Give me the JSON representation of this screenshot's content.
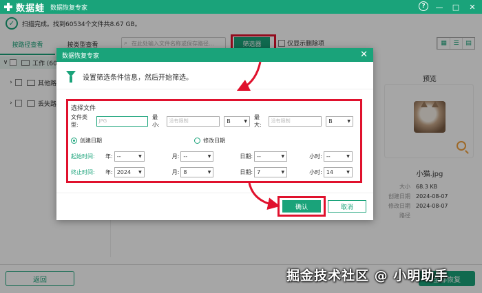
{
  "app": {
    "brand": "数据蛙",
    "subtitle": "数据恢复专家",
    "window_controls": [
      "?",
      "—",
      "□",
      "✕"
    ]
  },
  "status": {
    "text": "扫描完成。找到60534个文件共8.67 GB。"
  },
  "tabs": [
    "按路径查看",
    "按类型查看"
  ],
  "search": {
    "placeholder": "在此处输入文件名称或保存路径...",
    "filter_label": "筛选器",
    "only_deleted_label": "仅显示删除项"
  },
  "tree": {
    "items": [
      "工作 (6053",
      "其他路",
      "丢失路"
    ]
  },
  "preview": {
    "title": "预览",
    "file_name": "小猫.jpg",
    "meta": [
      {
        "key": "大小",
        "value": "68.3 KB"
      },
      {
        "key": "创建日期",
        "value": "2024-08-07"
      },
      {
        "key": "修改日期",
        "value": "2024-08-07"
      },
      {
        "key": "路径",
        "value": ""
      }
    ]
  },
  "bottom": {
    "back_label": "返回",
    "recover_label": "全部恢复",
    "watermark": "掘金技术社区 @ 小明助手"
  },
  "dialog": {
    "title": "数据恢复专家",
    "intro": "设置筛选条件信息，然后开始筛选。",
    "section_title": "选择文件",
    "file_type_label": "文件类型:",
    "file_type_placeholder": "JPG",
    "min_label": "最小:",
    "min_placeholder": "没有限制",
    "min_unit": "B",
    "max_label": "最大:",
    "max_placeholder": "没有限制",
    "max_unit": "B",
    "radio_created": "创建日期",
    "radio_modified": "修改日期",
    "start_label": "起始时间:",
    "end_label": "终止时间:",
    "year_label": "年:",
    "month_label": "月:",
    "day_label": "日期:",
    "hour_label": "小时:",
    "start": {
      "year": "--",
      "month": "--",
      "day": "--",
      "hour": "--"
    },
    "end": {
      "year": "2024",
      "month": "8",
      "day": "7",
      "hour": "14"
    },
    "ok_label": "确认",
    "cancel_label": "取消"
  },
  "colors": {
    "accent": "#1aa37a",
    "highlight": "#e0112d"
  }
}
